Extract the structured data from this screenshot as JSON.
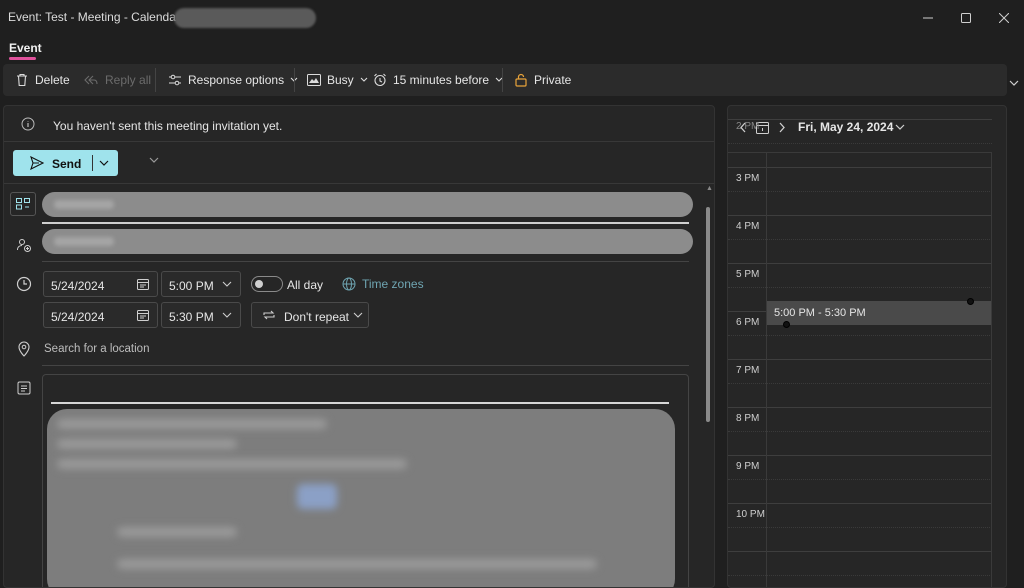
{
  "window": {
    "title": "Event: Test - Meeting - Calendar -"
  },
  "tabs": {
    "event": "Event"
  },
  "ribbon": {
    "delete": "Delete",
    "reply_all": "Reply all",
    "response_options": "Response options",
    "busy": "Busy",
    "reminder": "15 minutes before",
    "private": "Private"
  },
  "info": {
    "message": "You haven't sent this meeting invitation yet."
  },
  "send": {
    "label": "Send"
  },
  "form": {
    "start_date": "5/24/2024",
    "start_time": "5:00 PM",
    "end_date": "5/24/2024",
    "end_time": "5:30 PM",
    "all_day_label": "All day",
    "all_day": false,
    "time_zones": "Time zones",
    "repeat": "Don't repeat",
    "location_placeholder": "Search for a location"
  },
  "calendar": {
    "date": "Fri, May 24, 2024",
    "hours": [
      "3 PM",
      "4 PM",
      "5 PM",
      "6 PM",
      "7 PM",
      "8 PM",
      "9 PM",
      "10 PM"
    ],
    "event_label": "5:00 PM - 5:30 PM"
  },
  "colors": {
    "accent_pink": "#e0529c",
    "send_button": "#9fe3ec",
    "link_teal": "#6fa5b2",
    "private_icon": "#e8a33a"
  }
}
